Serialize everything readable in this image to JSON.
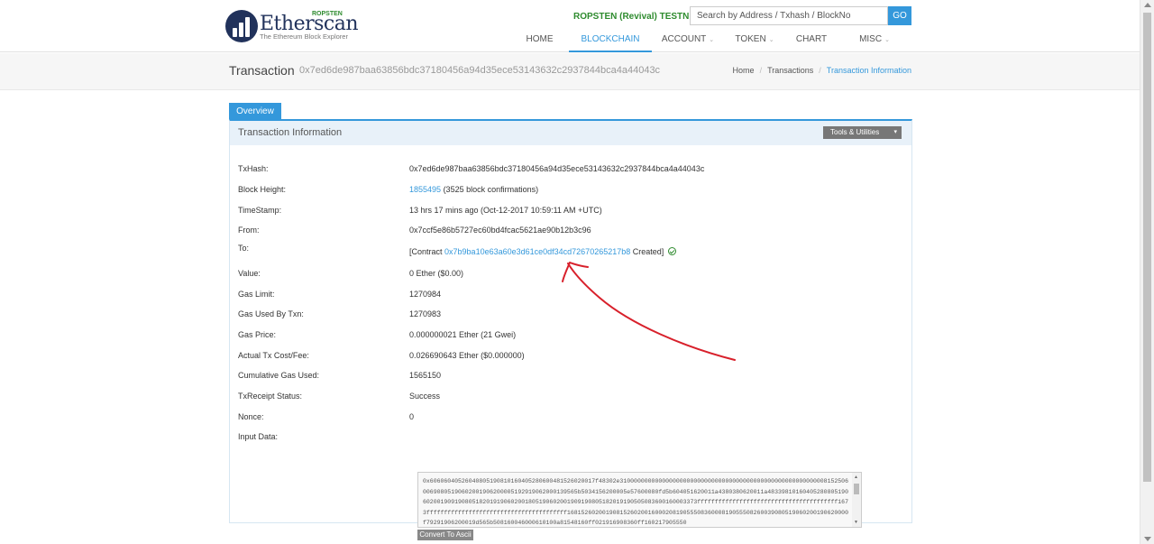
{
  "brand": {
    "name": "Etherscan",
    "tagline": "The Ethereum Block Explorer",
    "network_badge": "ROPSTEN",
    "brand_color": "#21325b"
  },
  "header": {
    "network_label": "ROPSTEN (Revival) TESTNET",
    "search_placeholder": "Search by Address / Txhash / BlockNo",
    "go_label": "GO",
    "nav": [
      {
        "label": "HOME",
        "dropdown": false
      },
      {
        "label": "BLOCKCHAIN",
        "dropdown": true,
        "active": true
      },
      {
        "label": "ACCOUNT",
        "dropdown": true
      },
      {
        "label": "TOKEN",
        "dropdown": true
      },
      {
        "label": "CHART",
        "dropdown": false
      },
      {
        "label": "MISC",
        "dropdown": true
      }
    ]
  },
  "title_bar": {
    "title": "Transaction",
    "hash": "0x7ed6de987baa63856bdc37180456a94d35ece53143632c2937844bca4a44043c",
    "breadcrumb": [
      "Home",
      "Transactions",
      "Transaction Information"
    ]
  },
  "tab": {
    "label": "Overview"
  },
  "panel": {
    "title": "Transaction Information",
    "tools_label": "Tools & Utilities"
  },
  "tx": {
    "txhash_label": "TxHash:",
    "txhash": "0x7ed6de987baa63856bdc37180456a94d35ece53143632c2937844bca4a44043c",
    "block_label": "Block Height:",
    "block_number": "1855495",
    "block_confirmations": "(3525 block confirmations)",
    "timestamp_label": "TimeStamp:",
    "timestamp": "13 hrs 17 mins ago (Oct-12-2017 10:59:11 AM +UTC)",
    "from_label": "From:",
    "from": "0x7ccf5e86b5727ec60bd4fcac5621ae90b12b3c96",
    "to_label": "To:",
    "to_prefix": "[Contract",
    "to_contract": "0x7b9ba10e63a60e3d61ce0df34cd72670265217b8",
    "to_suffix": "Created]",
    "value_label": "Value:",
    "value": "0 Ether ($0.00)",
    "gas_limit_label": "Gas Limit:",
    "gas_limit": "1270984",
    "gas_used_label": "Gas Used By Txn:",
    "gas_used": "1270983",
    "gas_price_label": "Gas Price:",
    "gas_price": "0.000000021 Ether (21 Gwei)",
    "fee_label": "Actual Tx Cost/Fee:",
    "fee": "0.026690643 Ether ($0.000000)",
    "cumulative_label": "Cumulative Gas Used:",
    "cumulative": "1565150",
    "receipt_label": "TxReceipt Status:",
    "receipt": "Success",
    "nonce_label": "Nonce:",
    "nonce": "0",
    "input_label": "Input Data:",
    "input_data": "0x6060604052604080519081016040528060048152602001​7f48302e310000000000000000000000000000000000000000000000000000000081525060069080519060200190620000519291906200013956​5b5034156200005e57600080fd5b604051620011a438038062001​1a48339810160405280805190602001909190805182019190602001805190602001909190805182019190505083600160003373ffffffffffffffffffffffffffffffffffffffff1673ffffffffffffffffffffffffffffffffffffffff16815260200190815260200160002081905550836000819055508260039080519060200190620000f79291906200019d565b508160046000610100a81548160ff021916908360ff160217905550",
    "convert_label": "Convert To Ascii"
  },
  "colors": {
    "accent": "#3498db",
    "testnet_green": "#2e8b2e",
    "annotation_red": "#d8202b"
  }
}
